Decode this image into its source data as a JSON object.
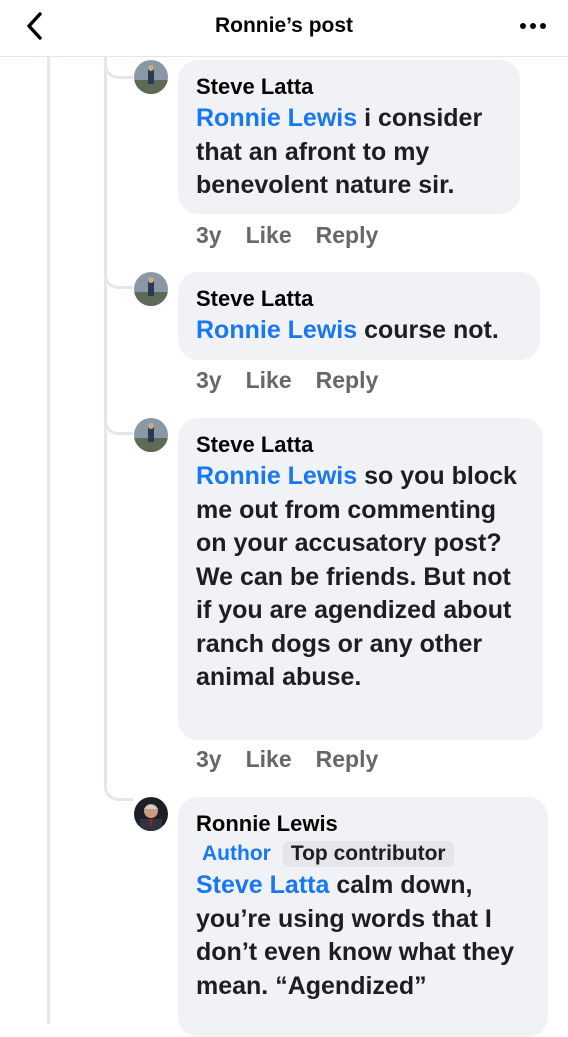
{
  "header": {
    "title": "Ronnie’s post",
    "back_icon": "chevron-left-icon",
    "more_icon": "more-horizontal-icon"
  },
  "comments": [
    {
      "author": "Steve Latta",
      "mention": "Ronnie Lewis",
      "text": " i consider that an afront to my benevolent nature sir.",
      "time": "3y",
      "like": "Like",
      "reply": "Reply"
    },
    {
      "author": "Steve Latta",
      "mention": "Ronnie Lewis",
      "text": " course not.",
      "time": "3y",
      "like": "Like",
      "reply": "Reply"
    },
    {
      "author": "Steve Latta",
      "mention": "Ronnie Lewis",
      "text": " so you block me out from commenting on your accusatory post? We can be friends. But not if you are agendized about ranch dogs or any other animal abuse.",
      "time": "3y",
      "like": "Like",
      "reply": "Reply"
    },
    {
      "author": "Ronnie Lewis",
      "author_badge": "Author",
      "contributor_badge": "Top contributor",
      "mention": "Steve Latta",
      "text": " calm down, you’re using words that I don’t even know what they mean. “Agendized”"
    }
  ],
  "colors": {
    "mention": "#1877f2",
    "bubble": "#f0f2f5",
    "meta_text": "#65676b",
    "thread_line": "#e4e6eb"
  }
}
